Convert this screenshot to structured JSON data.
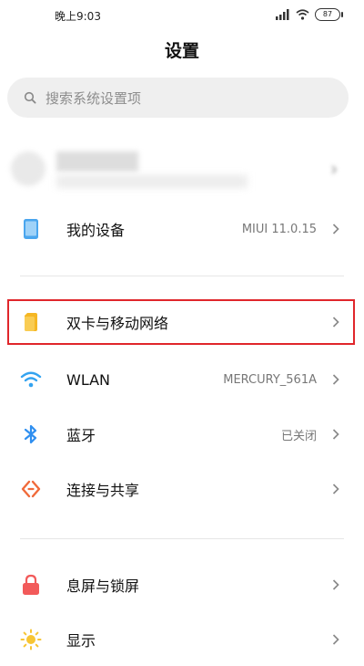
{
  "status_bar": {
    "time": "晚上9:03",
    "battery": "87",
    "icons": [
      "signal-icon",
      "wifi-icon",
      "battery-icon"
    ]
  },
  "header": {
    "title": "设置"
  },
  "search": {
    "placeholder": "搜索系统设置项"
  },
  "rows": {
    "my_device": {
      "label": "我的设备",
      "value": "MIUI 11.0.15",
      "icon": "phone-icon"
    },
    "sim_network": {
      "label": "双卡与移动网络",
      "icon": "sim-card-icon",
      "highlighted": true
    },
    "wlan": {
      "label": "WLAN",
      "value": "MERCURY_561A",
      "icon": "wifi-icon"
    },
    "bluetooth": {
      "label": "蓝牙",
      "value": "已关闭",
      "icon": "bluetooth-icon"
    },
    "connection_sharing": {
      "label": "连接与共享",
      "icon": "share-icon"
    },
    "lock_screen": {
      "label": "息屏与锁屏",
      "icon": "lock-icon"
    },
    "display": {
      "label": "显示",
      "icon": "sun-icon"
    }
  },
  "colors": {
    "highlight_border": "#e0262b",
    "device_icon": "#4aa6ee",
    "sim_icon": "#f5b724",
    "wifi_icon": "#33a3f0",
    "bluetooth_icon": "#2f8ff0",
    "share_icon": "#f06a3a",
    "lock_icon": "#f25a5a",
    "sun_icon": "#f7c534"
  }
}
